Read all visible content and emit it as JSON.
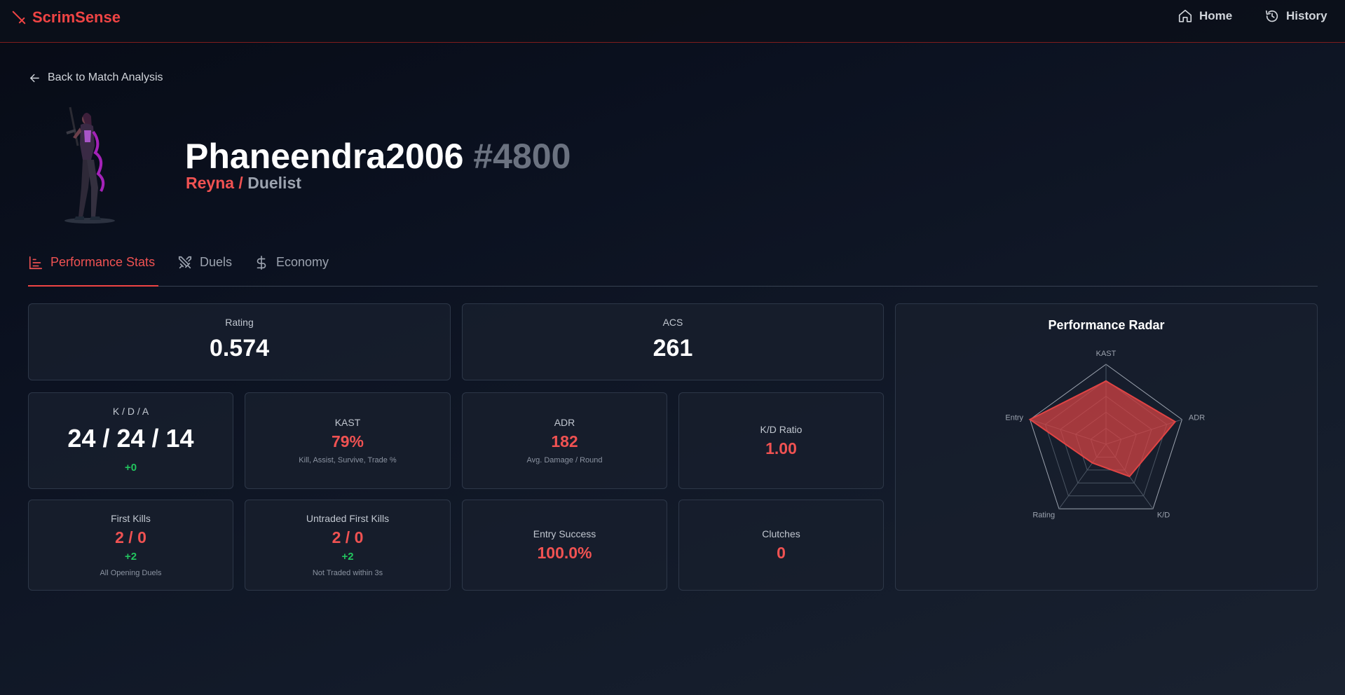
{
  "app": {
    "name": "ScrimSense",
    "accent": "#ef4444"
  },
  "nav": {
    "home": "Home",
    "history": "History"
  },
  "back_link": "Back to Match Analysis",
  "player": {
    "name": "Phaneendra2006",
    "tag": "#4800",
    "agent": "Reyna",
    "separator": " / ",
    "role": "Duelist"
  },
  "tabs": [
    {
      "label": "Performance Stats",
      "active": true,
      "icon": "bar-chart-icon"
    },
    {
      "label": "Duels",
      "active": false,
      "icon": "crossed-swords-icon"
    },
    {
      "label": "Economy",
      "active": false,
      "icon": "dollar-icon"
    }
  ],
  "stats": {
    "rating": {
      "label": "Rating",
      "value": "0.574"
    },
    "acs": {
      "label": "ACS",
      "value": "261"
    },
    "kda": {
      "label": "K / D / A",
      "value": "24 / 24 / 14",
      "diff": "+0"
    },
    "kast": {
      "label": "KAST",
      "value": "79%",
      "sub": "Kill, Assist, Survive, Trade %"
    },
    "adr": {
      "label": "ADR",
      "value": "182",
      "sub": "Avg. Damage / Round"
    },
    "kd_ratio": {
      "label": "K/D Ratio",
      "value": "1.00"
    },
    "first_kills": {
      "label": "First Kills",
      "value": "2 / 0",
      "diff": "+2",
      "sub": "All Opening Duels"
    },
    "untraded_fk": {
      "label": "Untraded First Kills",
      "value": "2 / 0",
      "diff": "+2",
      "sub": "Not Traded within 3s"
    },
    "entry_success": {
      "label": "Entry Success",
      "value": "100.0%"
    },
    "clutches": {
      "label": "Clutches",
      "value": "0"
    }
  },
  "radar": {
    "title": "Performance Radar",
    "axes": [
      "KAST",
      "ADR",
      "K/D",
      "Rating",
      "Entry"
    ],
    "values": [
      0.79,
      0.91,
      0.5,
      0.29,
      1.0
    ],
    "fill_color": "#e04444"
  }
}
